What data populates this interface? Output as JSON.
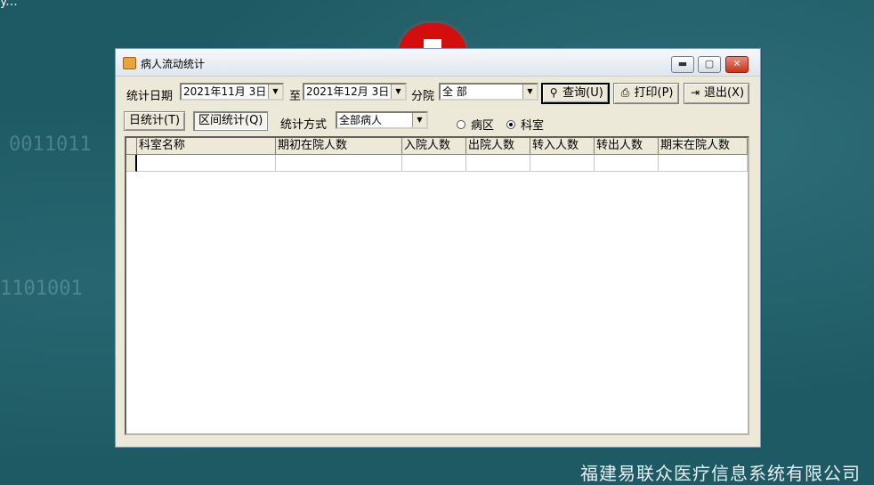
{
  "background": {
    "company_name": "福建易联众医疗信息系统有限公司",
    "corner_text": "y..."
  },
  "window": {
    "title": "病人流动统计",
    "controls": {
      "minimize": "▬",
      "maximize": "▢",
      "close": "✕"
    }
  },
  "toolbar": {
    "date_label": "统计日期",
    "start_date": "2021年11月 3日",
    "to_label": "至",
    "end_date": "2021年12月 3日",
    "branch_label": "分院",
    "branch_value": "全 部",
    "query_button": "查询(U)",
    "print_button": "打印(P)",
    "exit_button": "退出(X)"
  },
  "options": {
    "daily_tab": "日统计(T)",
    "range_tab": "区间统计(Q)",
    "method_label": "统计方式",
    "method_value": "全部病人",
    "radio_ward": "病区",
    "radio_dept": "科室",
    "selected": "科室"
  },
  "table": {
    "columns": [
      "科室名称",
      "期初在院人数",
      "入院人数",
      "出院人数",
      "转入人数",
      "转出人数",
      "期末在院人数"
    ],
    "rows": []
  },
  "colors": {
    "desktop": "#1d5a64",
    "window_face": "#ece9d8",
    "logo_red": "#d40d0d"
  }
}
